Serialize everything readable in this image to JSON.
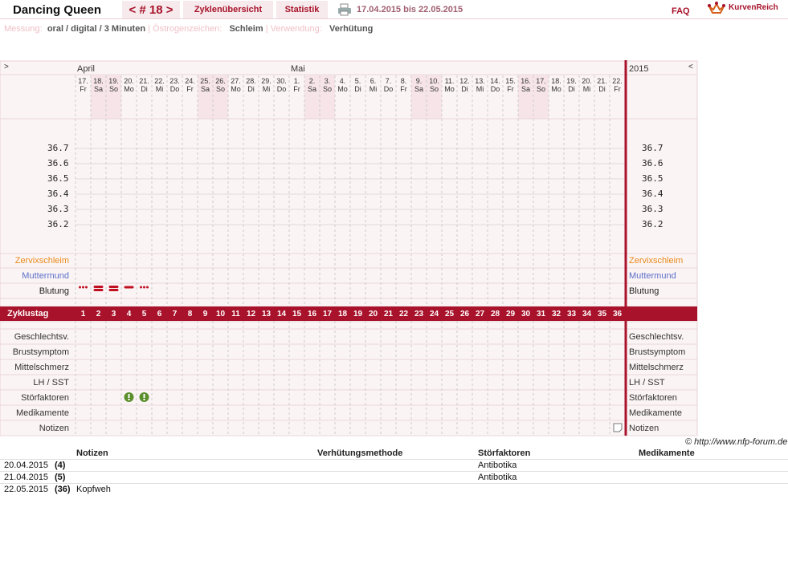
{
  "header": {
    "title": "Dancing Queen",
    "nav_cycle": "< # 18 >",
    "tab_overview": "Zyklenübersicht",
    "tab_stats": "Statistik",
    "date_range": "17.04.2015 bis 22.05.2015",
    "faq": "FAQ",
    "brand": "KurvenReich"
  },
  "meta": {
    "measure_label": "Messung:",
    "measure_value": "oral / digital / 3 Minuten",
    "estrogen_label": "Östrogenzeichen:",
    "estrogen_value": "Schleim",
    "usage_label": "Verwendung:",
    "usage_value": "Verhütung",
    "sep": "|"
  },
  "chart": {
    "nav_prev": ">",
    "nav_next": "<",
    "year": "2015",
    "months": [
      {
        "label": "April",
        "at_day": 0
      },
      {
        "label": "Mai",
        "at_day": 14
      }
    ],
    "days": [
      [
        "17.",
        "Fr"
      ],
      [
        "18.",
        "Sa"
      ],
      [
        "19.",
        "So"
      ],
      [
        "20.",
        "Mo"
      ],
      [
        "21.",
        "Di"
      ],
      [
        "22.",
        "Mi"
      ],
      [
        "23.",
        "Do"
      ],
      [
        "24.",
        "Fr"
      ],
      [
        "25.",
        "Sa"
      ],
      [
        "26.",
        "So"
      ],
      [
        "27.",
        "Mo"
      ],
      [
        "28.",
        "Di"
      ],
      [
        "29.",
        "Mi"
      ],
      [
        "30.",
        "Do"
      ],
      [
        "1.",
        "Fr"
      ],
      [
        "2.",
        "Sa"
      ],
      [
        "3.",
        "So"
      ],
      [
        "4.",
        "Mo"
      ],
      [
        "5.",
        "Di"
      ],
      [
        "6.",
        "Mi"
      ],
      [
        "7.",
        "Do"
      ],
      [
        "8.",
        "Fr"
      ],
      [
        "9.",
        "Sa"
      ],
      [
        "10.",
        "So"
      ],
      [
        "11.",
        "Mo"
      ],
      [
        "12.",
        "Di"
      ],
      [
        "13.",
        "Mi"
      ],
      [
        "14.",
        "Do"
      ],
      [
        "15.",
        "Fr"
      ],
      [
        "16.",
        "Sa"
      ],
      [
        "17.",
        "So"
      ],
      [
        "18.",
        "Mo"
      ],
      [
        "19.",
        "Di"
      ],
      [
        "20.",
        "Mi"
      ],
      [
        "21.",
        "Di"
      ],
      [
        "22.",
        "Fr"
      ]
    ],
    "temps": [
      "36.7",
      "36.6",
      "36.5",
      "36.4",
      "36.3",
      "36.2"
    ],
    "rows_top": [
      "Zervixschleim",
      "Muttermund",
      "Blutung"
    ],
    "zyklustag_label": "Zyklustag",
    "rows_bottom": [
      "Geschlechtsv.",
      "Brustsymptom",
      "Mittelschmerz",
      "LH / SST",
      "Störfaktoren",
      "Medikamente",
      "Notizen"
    ],
    "bleeding": [
      {
        "day": 1,
        "type": "light"
      },
      {
        "day": 2,
        "type": "heavy"
      },
      {
        "day": 3,
        "type": "heavy"
      },
      {
        "day": 4,
        "type": "medium"
      },
      {
        "day": 5,
        "type": "light"
      }
    ],
    "stoerfaktoren_days": [
      4,
      5
    ],
    "note_day": 36,
    "colors": {
      "accent": "#a8122a",
      "zervix": "#e88a1a",
      "muttermund": "#5b6fc8",
      "weekend": "#f6e4e8",
      "green": "#5a8f2c"
    }
  },
  "copyright": "© http://www.nfp-forum.de",
  "notes": {
    "headers": [
      "Notizen",
      "Verhütungsmethode",
      "Störfaktoren",
      "Medikamente"
    ],
    "rows": [
      {
        "date": "20.04.2015",
        "day": "(4)",
        "note": "",
        "method": "",
        "stoer": "Antibotika",
        "med": ""
      },
      {
        "date": "21.04.2015",
        "day": "(5)",
        "note": "",
        "method": "",
        "stoer": "Antibotika",
        "med": ""
      },
      {
        "date": "22.05.2015",
        "day": "(36)",
        "note": "Kopfweh",
        "method": "",
        "stoer": "",
        "med": ""
      }
    ]
  }
}
